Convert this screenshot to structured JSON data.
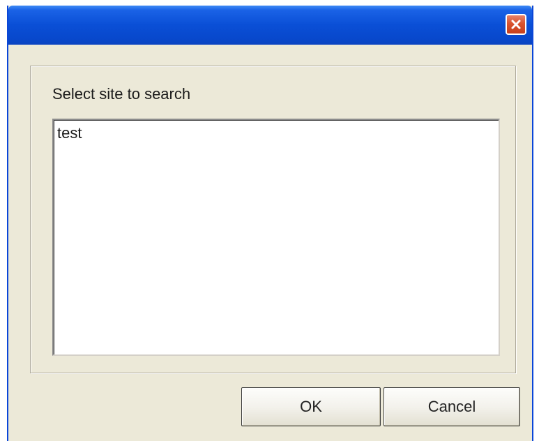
{
  "window": {
    "title": "",
    "close_icon": "close-x-icon"
  },
  "dialog": {
    "prompt_label": "Select site to search",
    "list": {
      "items": [
        "test"
      ]
    },
    "buttons": {
      "ok_label": "OK",
      "cancel_label": "Cancel"
    }
  },
  "colors": {
    "titlebar": "#0a4fd6",
    "close_button": "#d9532f",
    "dialog_background": "#ece9d8",
    "list_background": "#ffffff"
  }
}
